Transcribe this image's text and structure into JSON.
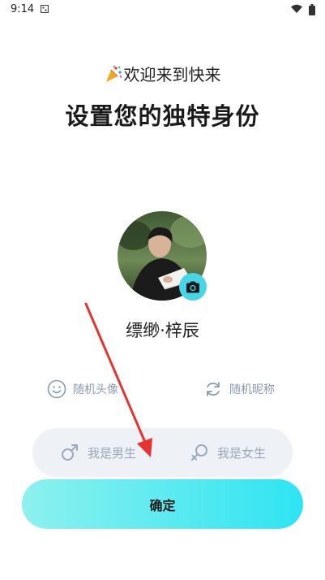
{
  "status_bar": {
    "time": "9:14"
  },
  "welcome": {
    "emoji": "🎉",
    "text": "欢迎来到快来"
  },
  "title": "设置您的独特身份",
  "nickname": "缥缈·梓辰",
  "random_avatar_label": "随机头像",
  "random_nickname_label": "随机昵称",
  "gender": {
    "male_label": "我是男生",
    "female_label": "我是女生"
  },
  "confirm_label": "确定",
  "colors": {
    "accent": "#2ee4f3",
    "accent_light": "#8ef1ee",
    "annotation_arrow": "#e8322f"
  }
}
